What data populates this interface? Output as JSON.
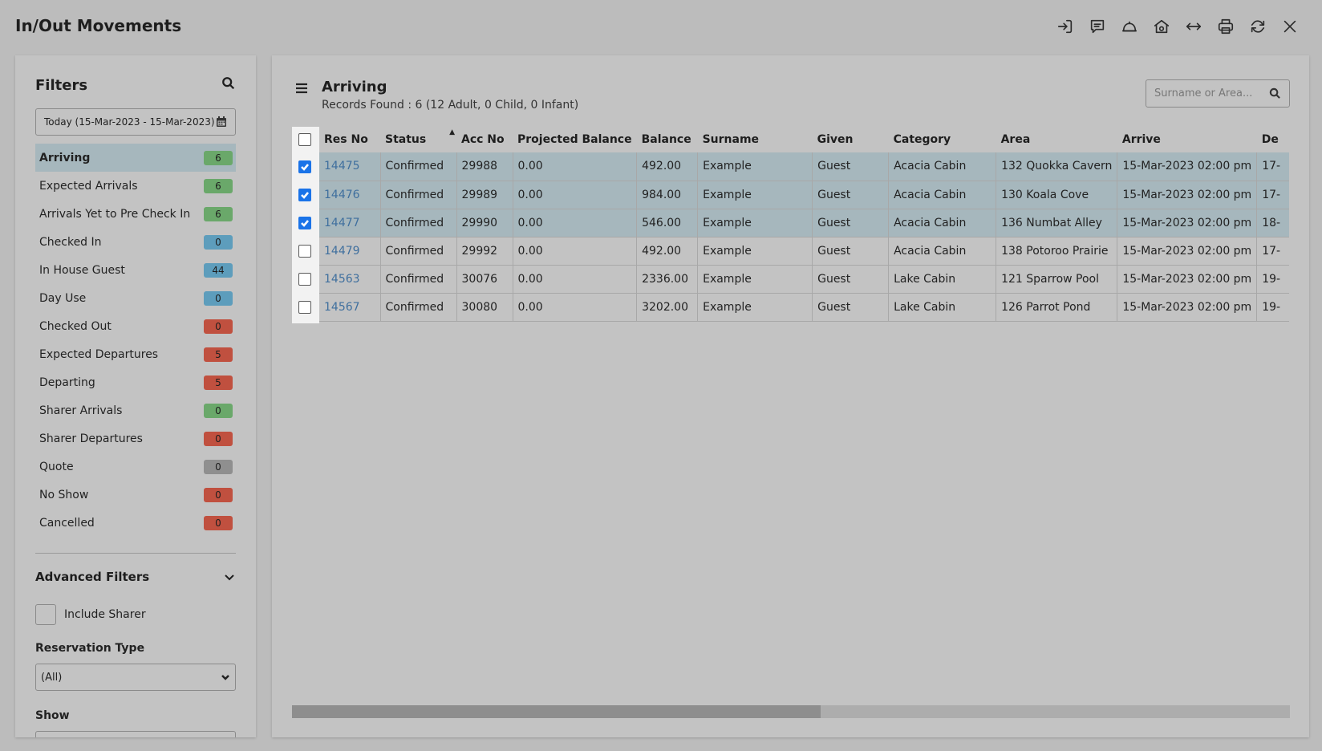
{
  "app": {
    "title": "In/Out Movements"
  },
  "toolbar": {
    "icons": [
      "check-in-icon",
      "message-icon",
      "bell-icon",
      "house-dollar-icon",
      "resize-horizontal-icon",
      "print-icon",
      "refresh-icon",
      "close-icon"
    ]
  },
  "filters": {
    "title": "Filters",
    "date_range": "Today (15-Mar-2023 - 15-Mar-2023)",
    "items": [
      {
        "label": "Arriving",
        "count": "6",
        "color": "#6aa86a",
        "active": true
      },
      {
        "label": "Expected Arrivals",
        "count": "6",
        "color": "#6aa86a"
      },
      {
        "label": "Arrivals Yet to Pre Check In",
        "count": "6",
        "color": "#6aa86a"
      },
      {
        "label": "Checked In",
        "count": "0",
        "color": "#5d9dbc"
      },
      {
        "label": "In House Guest",
        "count": "44",
        "color": "#5d9dbc"
      },
      {
        "label": "Day Use",
        "count": "0",
        "color": "#5d9dbc"
      },
      {
        "label": "Checked Out",
        "count": "0",
        "color": "#c0503f"
      },
      {
        "label": "Expected Departures",
        "count": "5",
        "color": "#c0503f"
      },
      {
        "label": "Departing",
        "count": "5",
        "color": "#c0503f"
      },
      {
        "label": "Sharer Arrivals",
        "count": "0",
        "color": "#6aa86a"
      },
      {
        "label": "Sharer Departures",
        "count": "0",
        "color": "#c0503f"
      },
      {
        "label": "Quote",
        "count": "0",
        "color": "#8f8f8f"
      },
      {
        "label": "No Show",
        "count": "0",
        "color": "#c0503f"
      },
      {
        "label": "Cancelled",
        "count": "0",
        "color": "#c0503f"
      }
    ],
    "advanced_title": "Advanced Filters",
    "include_sharer_label": "Include Sharer",
    "reservation_type_label": "Reservation Type",
    "reservation_type_value": "(All)",
    "show_label": "Show"
  },
  "main": {
    "title": "Arriving",
    "records_found": "Records Found : 6 (12 Adult, 0 Child, 0 Infant)",
    "search_placeholder": "Surname or Area...",
    "columns": [
      "Res No",
      "Status",
      "Acc No",
      "Projected Balance",
      "Balance",
      "Surname",
      "Given",
      "Category",
      "Area",
      "Arrive",
      "De"
    ],
    "rows": [
      {
        "selected": true,
        "cells": [
          "14475",
          "Confirmed",
          "29988",
          "0.00",
          "492.00",
          "Example",
          "Guest",
          "Acacia Cabin",
          "132 Quokka Cavern",
          "15-Mar-2023 02:00 pm",
          "17-"
        ]
      },
      {
        "selected": true,
        "cells": [
          "14476",
          "Confirmed",
          "29989",
          "0.00",
          "984.00",
          "Example",
          "Guest",
          "Acacia Cabin",
          "130 Koala Cove",
          "15-Mar-2023 02:00 pm",
          "17-"
        ]
      },
      {
        "selected": true,
        "cells": [
          "14477",
          "Confirmed",
          "29990",
          "0.00",
          "546.00",
          "Example",
          "Guest",
          "Acacia Cabin",
          "136 Numbat Alley",
          "15-Mar-2023 02:00 pm",
          "18-"
        ]
      },
      {
        "selected": false,
        "cells": [
          "14479",
          "Confirmed",
          "29992",
          "0.00",
          "492.00",
          "Example",
          "Guest",
          "Acacia Cabin",
          "138 Potoroo Prairie",
          "15-Mar-2023 02:00 pm",
          "17-"
        ]
      },
      {
        "selected": false,
        "cells": [
          "14563",
          "Confirmed",
          "30076",
          "0.00",
          "2336.00",
          "Example",
          "Guest",
          "Lake Cabin",
          "121 Sparrow Pool",
          "15-Mar-2023 02:00 pm",
          "19-"
        ]
      },
      {
        "selected": false,
        "cells": [
          "14567",
          "Confirmed",
          "30080",
          "0.00",
          "3202.00",
          "Example",
          "Guest",
          "Lake Cabin",
          "126 Parrot Pond",
          "15-Mar-2023 02:00 pm",
          "19-"
        ]
      }
    ],
    "scroll_position": 0.53
  }
}
